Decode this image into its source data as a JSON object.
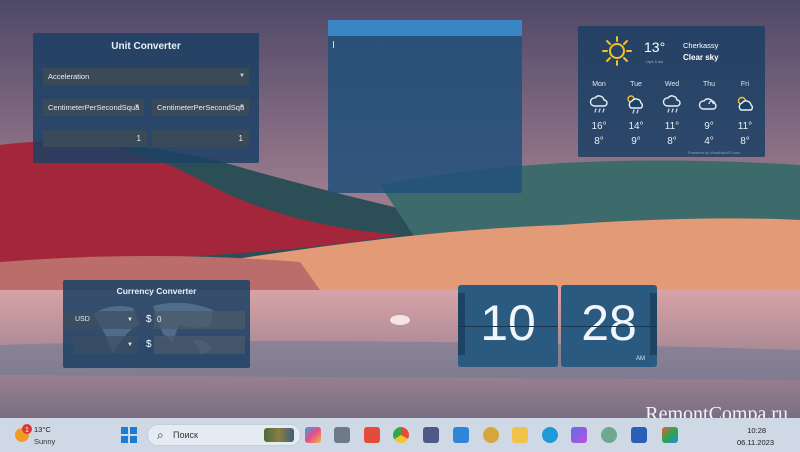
{
  "unit_converter": {
    "title": "Unit Converter",
    "category": "Acceleration",
    "from_unit": "CentimeterPerSecondSqua",
    "to_unit": "CentimeterPerSecondSqu",
    "from_value": "1",
    "to_value": "1"
  },
  "weather": {
    "temperature": "13°",
    "updated": "Upd 4 ms",
    "city": "Cherkassy",
    "condition": "Clear sky",
    "powered_by": "Powered by WeatherAPI.com",
    "days": [
      {
        "name": "Mon",
        "high": "16°",
        "low": "8°",
        "icon": "rain-cloud-icon"
      },
      {
        "name": "Tue",
        "high": "14°",
        "low": "9°",
        "icon": "sun-rain-cloud-icon"
      },
      {
        "name": "Wed",
        "high": "11°",
        "low": "8°",
        "icon": "rain-cloud-icon"
      },
      {
        "name": "Thu",
        "high": "9°",
        "low": "4°",
        "icon": "cloud-icon"
      },
      {
        "name": "Fri",
        "high": "11°",
        "low": "8°",
        "icon": "sun-cloud-icon"
      }
    ]
  },
  "currency_converter": {
    "title": "Currency Converter",
    "from_currency": "USD",
    "to_currency": "",
    "symbol_from": "$",
    "symbol_to": "$",
    "amount": "0",
    "result": ""
  },
  "flip_clock": {
    "hours": "10",
    "minutes": "28",
    "ampm": "AM"
  },
  "watermark": "RemontCompa.ru",
  "taskbar": {
    "weather_temp": "13°C",
    "weather_cond": "Sunny",
    "weather_badge": "1",
    "search_placeholder": "Поиск",
    "time": "10:28",
    "date": "06.11.2023",
    "apps": [
      "widgets-icon",
      "task-view-icon",
      "recorder-icon",
      "chrome-icon",
      "floppy-save-icon",
      "checkmark-todo-icon",
      "eye-app-icon",
      "file-explorer-icon",
      "skype-icon",
      "copilot-icon",
      "chatgpt-icon",
      "word-icon",
      "store-icon"
    ]
  },
  "colors": {
    "panel": "#1c4064",
    "accent_bar": "#3a86c4",
    "taskbar": "#cfd9e6"
  }
}
